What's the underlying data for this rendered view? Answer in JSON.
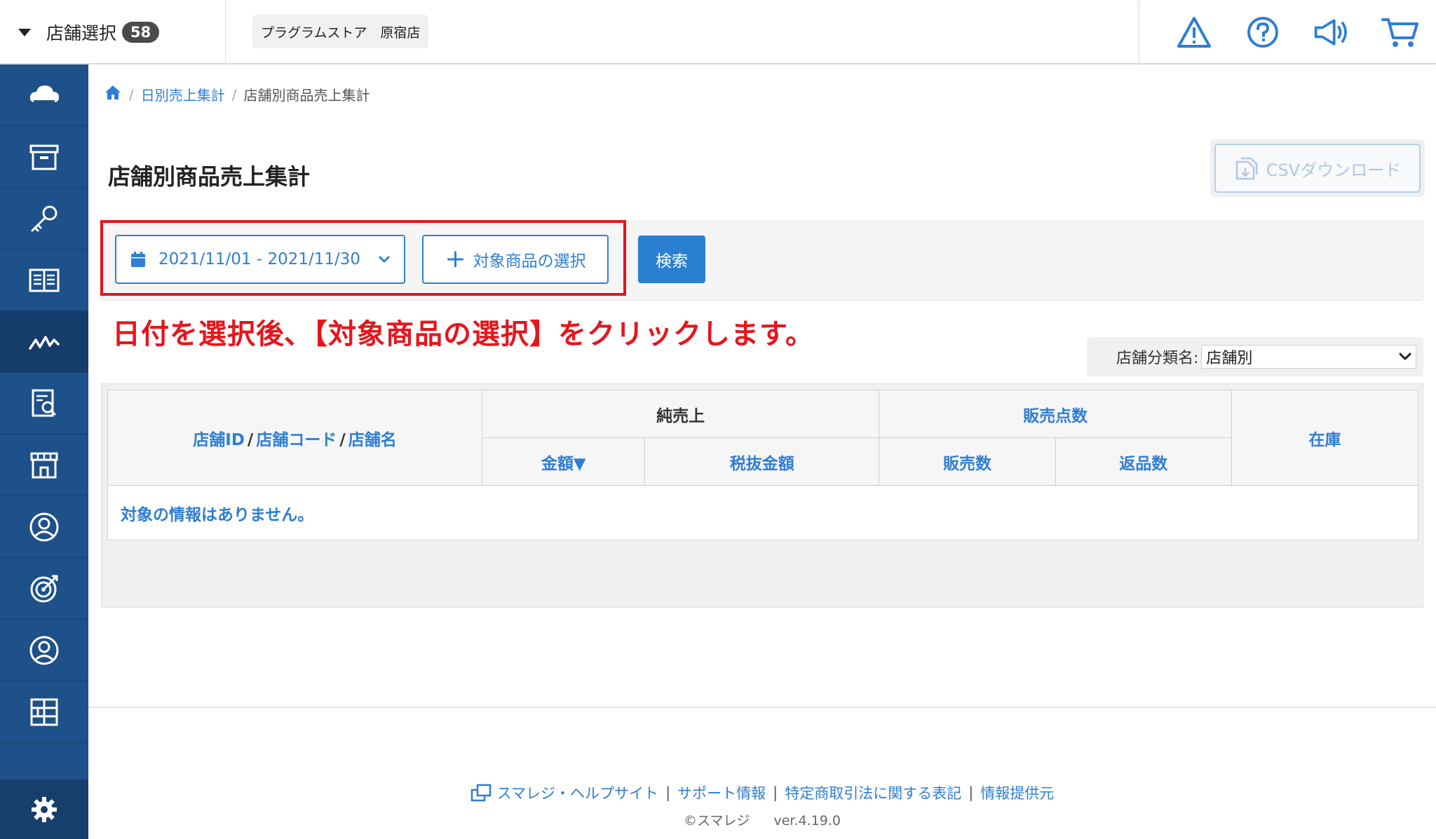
{
  "header": {
    "store_select_label": "店舗選択",
    "store_count": "58",
    "current_store": "プラグラムストア　原宿店"
  },
  "breadcrumb": {
    "items": [
      {
        "label": "日別売上集計"
      },
      {
        "label": "店舗別商品売上集計"
      }
    ],
    "separator": "/"
  },
  "page": {
    "title": "店舗別商品売上集計",
    "csv_button": "CSVダウンロード"
  },
  "filters": {
    "date_range": "2021/11/01 - 2021/11/30",
    "add_product_button": "対象商品の選択",
    "search_button": "検索"
  },
  "annotation": "日付を選択後､【対象商品の選択】をクリックします。",
  "category": {
    "label": "店舗分類名:",
    "selected": "店舗別"
  },
  "table": {
    "col_store": [
      "店舗ID",
      "店舗コード",
      "店舗名"
    ],
    "col_store_sep": "/",
    "group_net_sales": "純売上",
    "group_sales_points": "販売点数",
    "col_amount": "金額▼",
    "col_amount_excl_tax": "税抜金額",
    "col_sold_count": "販売数",
    "col_return_count": "返品数",
    "col_stock": "在庫",
    "empty_message": "対象の情報はありません。"
  },
  "footer": {
    "links": [
      "スマレジ・ヘルプサイト",
      "サポート情報",
      "特定商取引法に関する表記",
      "情報提供元"
    ],
    "separator": "|",
    "copyright": "©スマレジ",
    "version": "ver.4.19.0"
  },
  "colors": {
    "sidebar": "#1e5089",
    "accent": "#2f7ed4",
    "highlight": "#e8141c"
  }
}
